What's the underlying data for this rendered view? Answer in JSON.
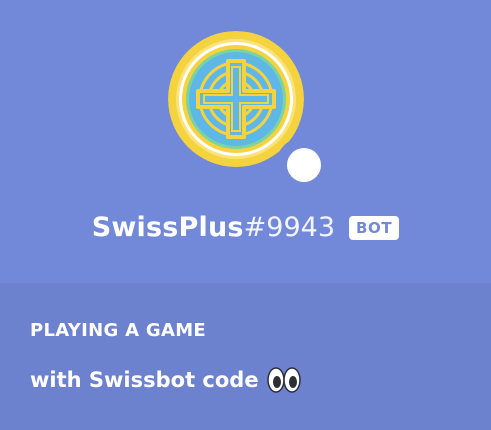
{
  "profile": {
    "username": "SwissPlus",
    "discriminator": "#9943",
    "badge": "BOT",
    "status": "online-white"
  },
  "activity": {
    "header": "PLAYING A GAME",
    "details": "with Swissbot code",
    "emoji_icon": "eyes-emoji-icon"
  },
  "colors": {
    "blurple": "#7289da",
    "activity_bg": "#6c82cf",
    "avatar_gold": "#f5d33f",
    "avatar_blue": "#5fb7e8",
    "avatar_green": "#7bd3a0",
    "white": "#ffffff"
  }
}
